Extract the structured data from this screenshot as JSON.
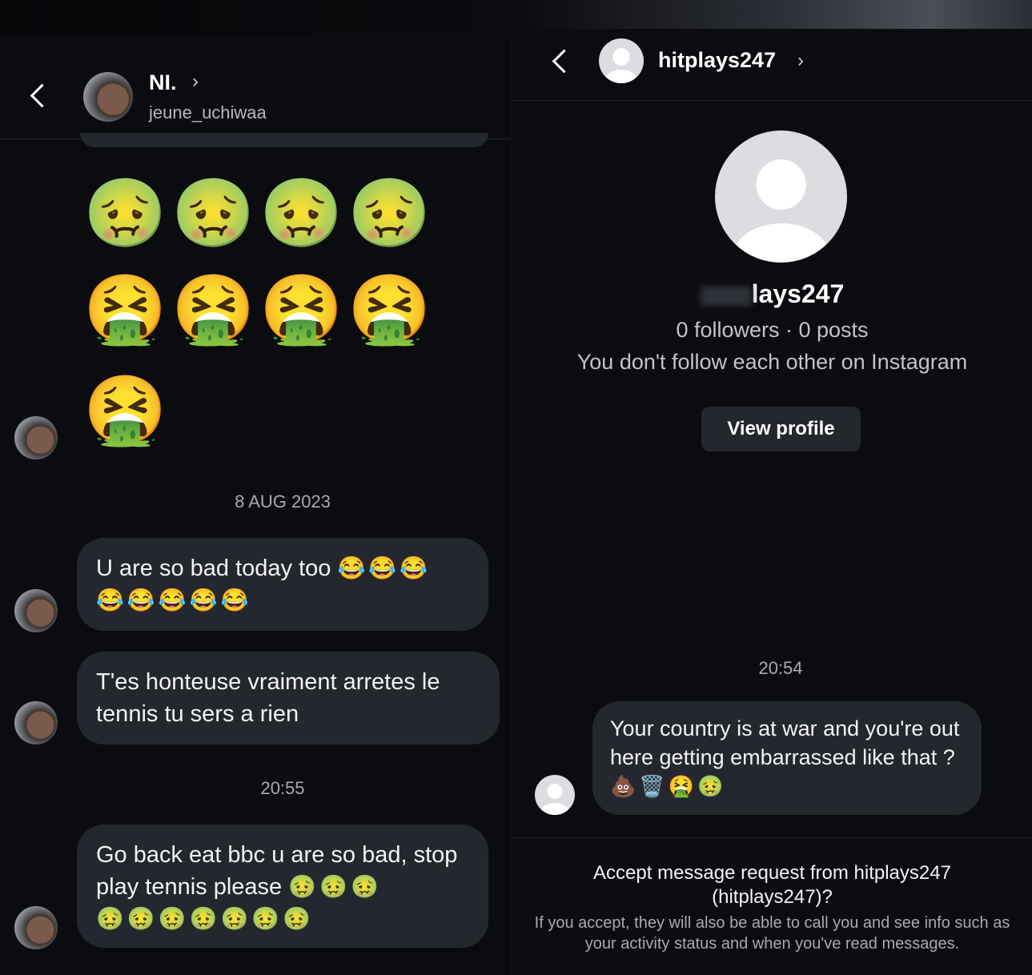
{
  "left": {
    "header": {
      "name": "NI.",
      "username": "jeune_uchiwaa",
      "arrow": "›"
    },
    "emoji_rows": [
      [
        "🤢",
        "🤢",
        "🤢",
        "🤢"
      ],
      [
        "🤮",
        "🤮",
        "🤮",
        "🤮"
      ],
      [
        "🤮"
      ]
    ],
    "date_stamp": "8 AUG 2023",
    "messages": [
      {
        "text": "U are so bad today too",
        "emojis": "😂😂😂",
        "emojis2": "😂😂😂😂😂"
      },
      {
        "text": "T'es honteuse vraiment arretes le tennis tu sers a rien"
      },
      {
        "text": "Go back eat bbc u are so bad, stop play tennis please",
        "emojis": "🤢🤢🤢",
        "emojis2": "🤢🤢🤢🤢🤢🤢🤢"
      }
    ],
    "time_stamp": "20:55"
  },
  "right": {
    "header": {
      "name": "hitplays247",
      "arrow": "›"
    },
    "profile": {
      "name_visible": "lays247",
      "stats": "0 followers · 0 posts",
      "relation": "You don't follow each other on Instagram",
      "view_profile": "View profile"
    },
    "time_stamp": "20:54",
    "message": {
      "text": "Your country is at war and you're out here getting embarrassed like that ?",
      "emojis": "💩🗑️🤮🤢"
    },
    "request": {
      "title": "Accept message request from hitplays247 (hitplays247)?",
      "body": "If you accept, they will also be able to call you and see info such as your activity status and when you've read messages."
    }
  }
}
